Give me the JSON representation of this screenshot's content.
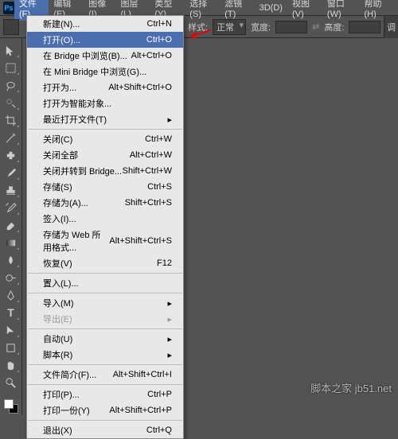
{
  "app": {
    "logo": "Ps"
  },
  "menubar": {
    "items": [
      {
        "label": "文件(F)"
      },
      {
        "label": "编辑(E)"
      },
      {
        "label": "图像(I)"
      },
      {
        "label": "图层(L)"
      },
      {
        "label": "类型(Y)"
      },
      {
        "label": "选择(S)"
      },
      {
        "label": "滤镜(T)"
      },
      {
        "label": "3D(D)"
      },
      {
        "label": "视图(V)"
      },
      {
        "label": "窗口(W)"
      },
      {
        "label": "帮助(H)"
      }
    ]
  },
  "optionsbar": {
    "style_label": "样式:",
    "style_value": "正常",
    "width_label": "宽度:",
    "height_label": "高度:",
    "adjust_label": "调"
  },
  "dropdown": {
    "groups": [
      [
        {
          "label": "新建(N)...",
          "shortcut": "Ctrl+N"
        },
        {
          "label": "打开(O)...",
          "shortcut": "Ctrl+O",
          "hl": true
        },
        {
          "label": "在 Bridge 中浏览(B)...",
          "shortcut": "Alt+Ctrl+O"
        },
        {
          "label": "在 Mini Bridge 中浏览(G)..."
        },
        {
          "label": "打开为...",
          "shortcut": "Alt+Shift+Ctrl+O"
        },
        {
          "label": "打开为智能对象..."
        },
        {
          "label": "最近打开文件(T)",
          "sub": true
        }
      ],
      [
        {
          "label": "关闭(C)",
          "shortcut": "Ctrl+W"
        },
        {
          "label": "关闭全部",
          "shortcut": "Alt+Ctrl+W"
        },
        {
          "label": "关闭并转到 Bridge...",
          "shortcut": "Shift+Ctrl+W"
        },
        {
          "label": "存储(S)",
          "shortcut": "Ctrl+S"
        },
        {
          "label": "存储为(A)...",
          "shortcut": "Shift+Ctrl+S"
        },
        {
          "label": "签入(I)..."
        },
        {
          "label": "存储为 Web 所用格式...",
          "shortcut": "Alt+Shift+Ctrl+S"
        },
        {
          "label": "恢复(V)",
          "shortcut": "F12"
        }
      ],
      [
        {
          "label": "置入(L)..."
        }
      ],
      [
        {
          "label": "导入(M)",
          "sub": true
        },
        {
          "label": "导出(E)",
          "sub": true,
          "disabled": true
        }
      ],
      [
        {
          "label": "自动(U)",
          "sub": true
        },
        {
          "label": "脚本(R)",
          "sub": true
        }
      ],
      [
        {
          "label": "文件简介(F)...",
          "shortcut": "Alt+Shift+Ctrl+I"
        }
      ],
      [
        {
          "label": "打印(P)...",
          "shortcut": "Ctrl+P"
        },
        {
          "label": "打印一份(Y)",
          "shortcut": "Alt+Shift+Ctrl+P"
        }
      ],
      [
        {
          "label": "退出(X)",
          "shortcut": "Ctrl+Q"
        }
      ]
    ]
  },
  "watermark": "脚本之家 jb51.net"
}
